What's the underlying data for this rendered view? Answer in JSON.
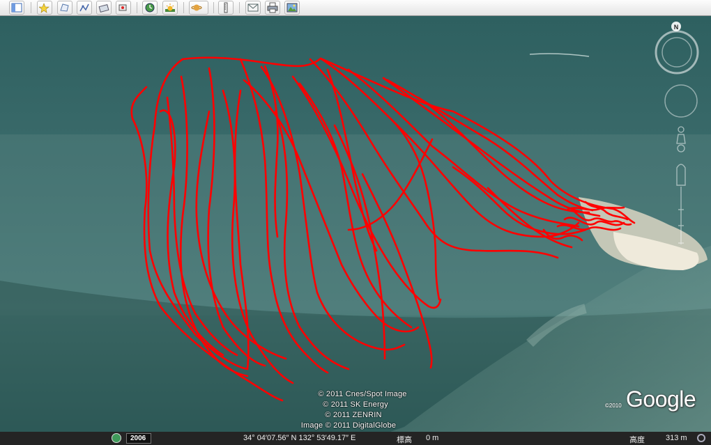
{
  "toolbar": {
    "buttons": [
      {
        "icon": "sidebar-toggle-icon"
      },
      {
        "icon": "add-placemark-icon"
      },
      {
        "icon": "add-polygon-icon"
      },
      {
        "icon": "add-path-icon"
      },
      {
        "icon": "add-image-overlay-icon"
      },
      {
        "icon": "record-tour-icon"
      },
      {
        "icon": "historical-imagery-icon"
      },
      {
        "icon": "sunlight-icon"
      },
      {
        "icon": "switch-to-planet-icon"
      },
      {
        "icon": "ruler-icon"
      },
      {
        "icon": "email-icon"
      },
      {
        "icon": "print-icon"
      },
      {
        "icon": "save-image-icon"
      }
    ]
  },
  "map": {
    "attribution": [
      "© 2011 Cnes/Spot Image",
      "© 2011 SK Energy",
      "© 2011 ZENRIN",
      "Image © 2011 DigitalGlobe"
    ],
    "logo": "Google",
    "logo_year": "©2010",
    "track_color": "#ff0000"
  },
  "navigation": {
    "compass_north_label": "N",
    "icons": [
      "compass-ring-icon",
      "look-joystick-icon",
      "street-view-pegman-icon",
      "zoom-slider-icon"
    ]
  },
  "status": {
    "imagery_year": "2006",
    "coordinates": "34° 04′07.56″ N 132° 53′49.17″ E",
    "elevation_label": "標高",
    "elevation_value": "0 m",
    "eye_alt_label": "高度",
    "eye_alt_value": "313 m"
  }
}
